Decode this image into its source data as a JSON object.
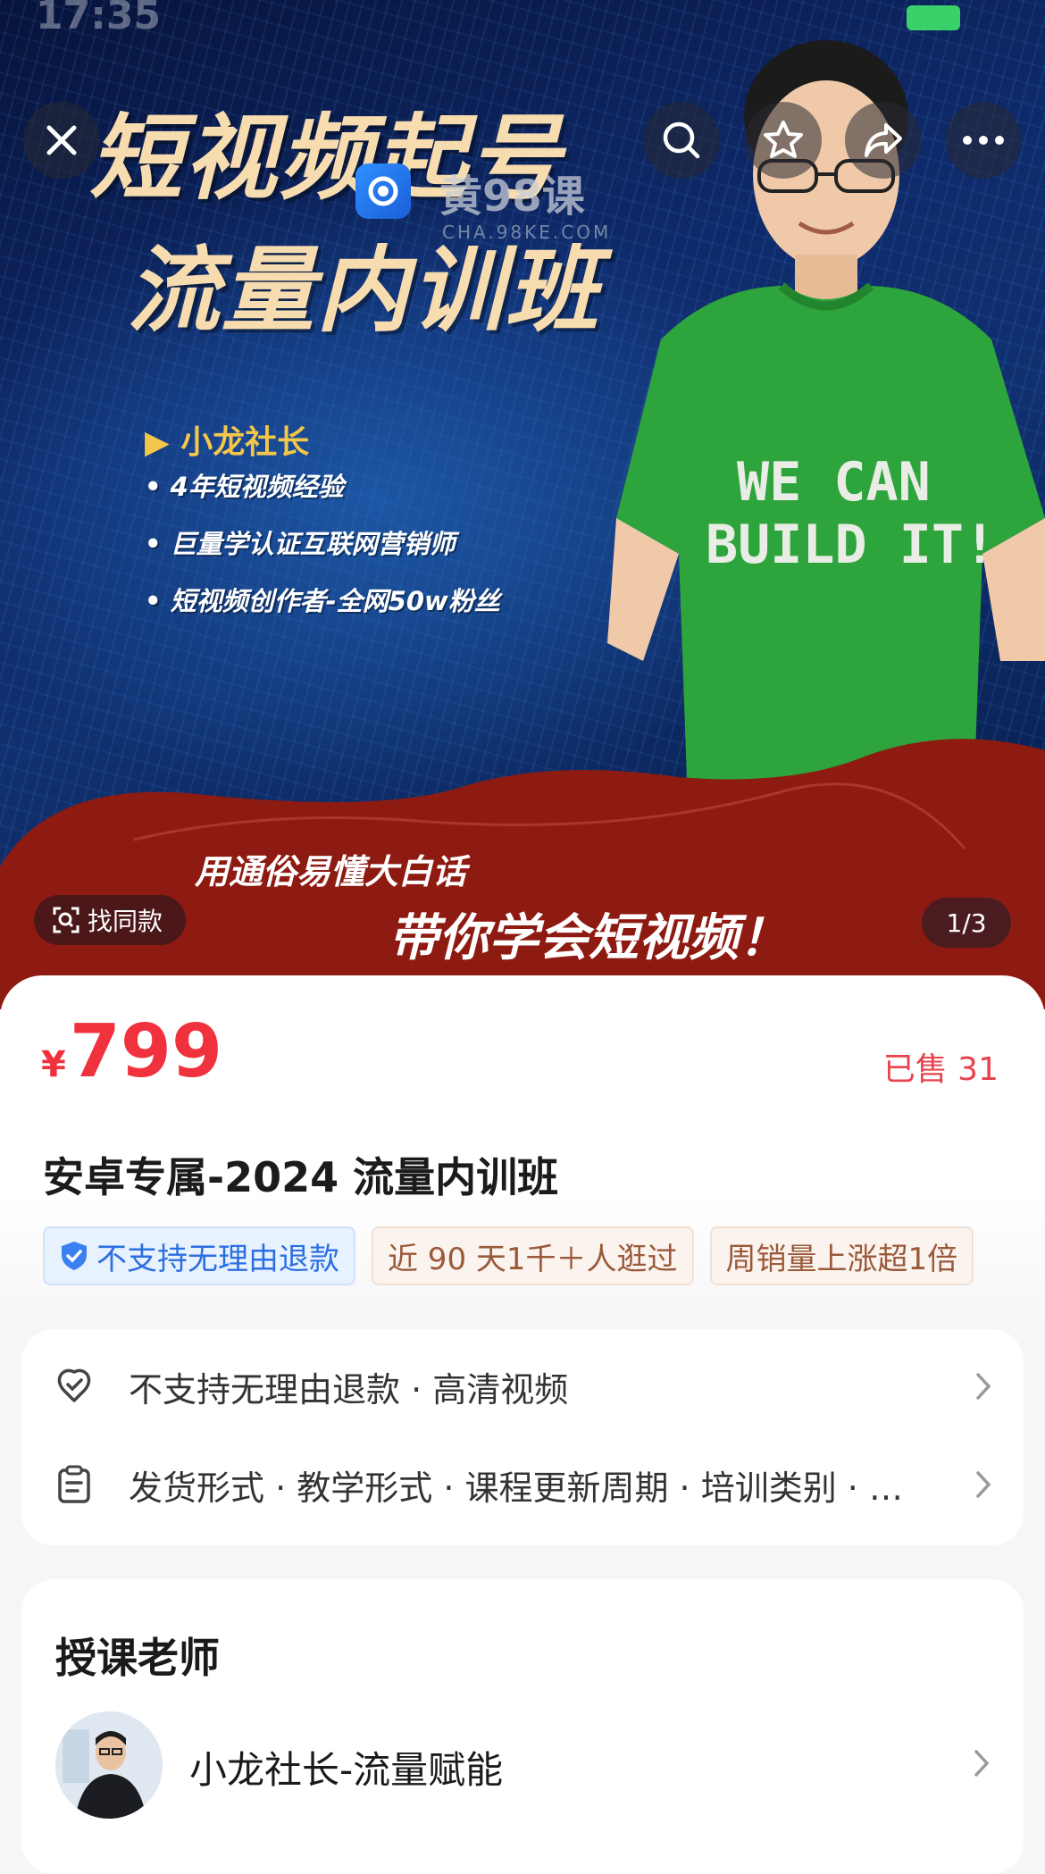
{
  "status_bar": {
    "time": "17:35"
  },
  "hero": {
    "title_line1": "短视频起号",
    "title_line2": "流量内训班",
    "author": "▶ 小龙社长",
    "bullets": [
      "4年短视频经验",
      "巨量学认证互联网营销师",
      "短视频创作者-全网50w粉丝"
    ],
    "shirt_text_line1": "WE CAN",
    "shirt_text_line2": "BUILD IT!",
    "slogan_line1": "用通俗易懂大白话",
    "slogan_line2": "带你学会短视频！",
    "watermark_text": "黄98课",
    "watermark_sub": "CHA.98KE.COM",
    "find_similar_label": "找同款",
    "page_indicator": "1/3"
  },
  "product": {
    "currency": "¥",
    "price": "799",
    "sold": "已售 31",
    "title": "安卓专属-2024 流量内训班",
    "tags": [
      {
        "label": "不支持无理由退款",
        "style": "blue",
        "icon": "shield-check-icon"
      },
      {
        "label": "近 90 天1千＋人逛过",
        "style": "beige"
      },
      {
        "label": "周销量上涨超1倍",
        "style": "beige"
      }
    ]
  },
  "service": {
    "rows": [
      {
        "icon": "heart-shield-icon",
        "text": "不支持无理由退款 · 高清视频"
      },
      {
        "icon": "clipboard-icon",
        "text": "发货形式 · 教学形式 · 课程更新周期 · 培训类别 · …"
      }
    ]
  },
  "teacher_section": {
    "title": "授课老师",
    "teacher_name": "小龙社长-流量赋能"
  },
  "colors": {
    "price_red": "#f0323e",
    "tag_blue": "#2c6fe0",
    "tag_beige_text": "#9a5a3a",
    "hero_accent": "#f4c64a"
  }
}
